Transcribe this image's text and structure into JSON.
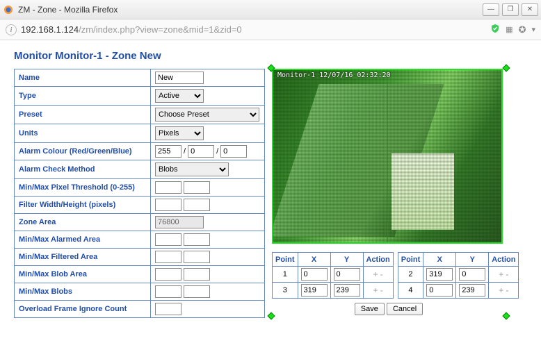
{
  "window": {
    "title": "ZM - Zone - Mozilla Firefox"
  },
  "url": {
    "host": "192.168.1.124",
    "path": "/zm/index.php?view=zone&mid=1&zid=0"
  },
  "heading": "Monitor Monitor-1 - Zone New",
  "labels": {
    "name": "Name",
    "type": "Type",
    "preset": "Preset",
    "units": "Units",
    "alarm_colour": "Alarm Colour (Red/Green/Blue)",
    "alarm_check": "Alarm Check Method",
    "pixel_thresh": "Min/Max Pixel Threshold (0-255)",
    "filter_wh": "Filter Width/Height (pixels)",
    "zone_area": "Zone Area",
    "alarmed_area": "Min/Max Alarmed Area",
    "filtered_area": "Min/Max Filtered Area",
    "blob_area": "Min/Max Blob Area",
    "blobs": "Min/Max Blobs",
    "overload": "Overload Frame Ignore Count"
  },
  "values": {
    "name": "New",
    "type": "Active",
    "preset": "Choose Preset",
    "units": "Pixels",
    "r": "255",
    "g": "0",
    "b": "0",
    "alarm_check": "Blobs",
    "pixel_min": "",
    "pixel_max": "",
    "filter_w": "",
    "filter_h": "",
    "zone_area": "76800",
    "alarmed_min": "",
    "alarmed_max": "",
    "filtered_min": "",
    "filtered_max": "",
    "blobarea_min": "",
    "blobarea_max": "",
    "blobs_min": "",
    "blobs_max": "",
    "overload": ""
  },
  "preview": {
    "overlay": "Monitor-1   12/07/16 02:32:20"
  },
  "points_header": {
    "point": "Point",
    "x": "X",
    "y": "Y",
    "action": "Action"
  },
  "points": [
    {
      "n": "1",
      "x": "0",
      "y": "0"
    },
    {
      "n": "2",
      "x": "319",
      "y": "0"
    },
    {
      "n": "3",
      "x": "319",
      "y": "239"
    },
    {
      "n": "4",
      "x": "0",
      "y": "239"
    }
  ],
  "buttons": {
    "save": "Save",
    "cancel": "Cancel"
  },
  "action_glyphs": {
    "add": "+",
    "del": "-"
  }
}
